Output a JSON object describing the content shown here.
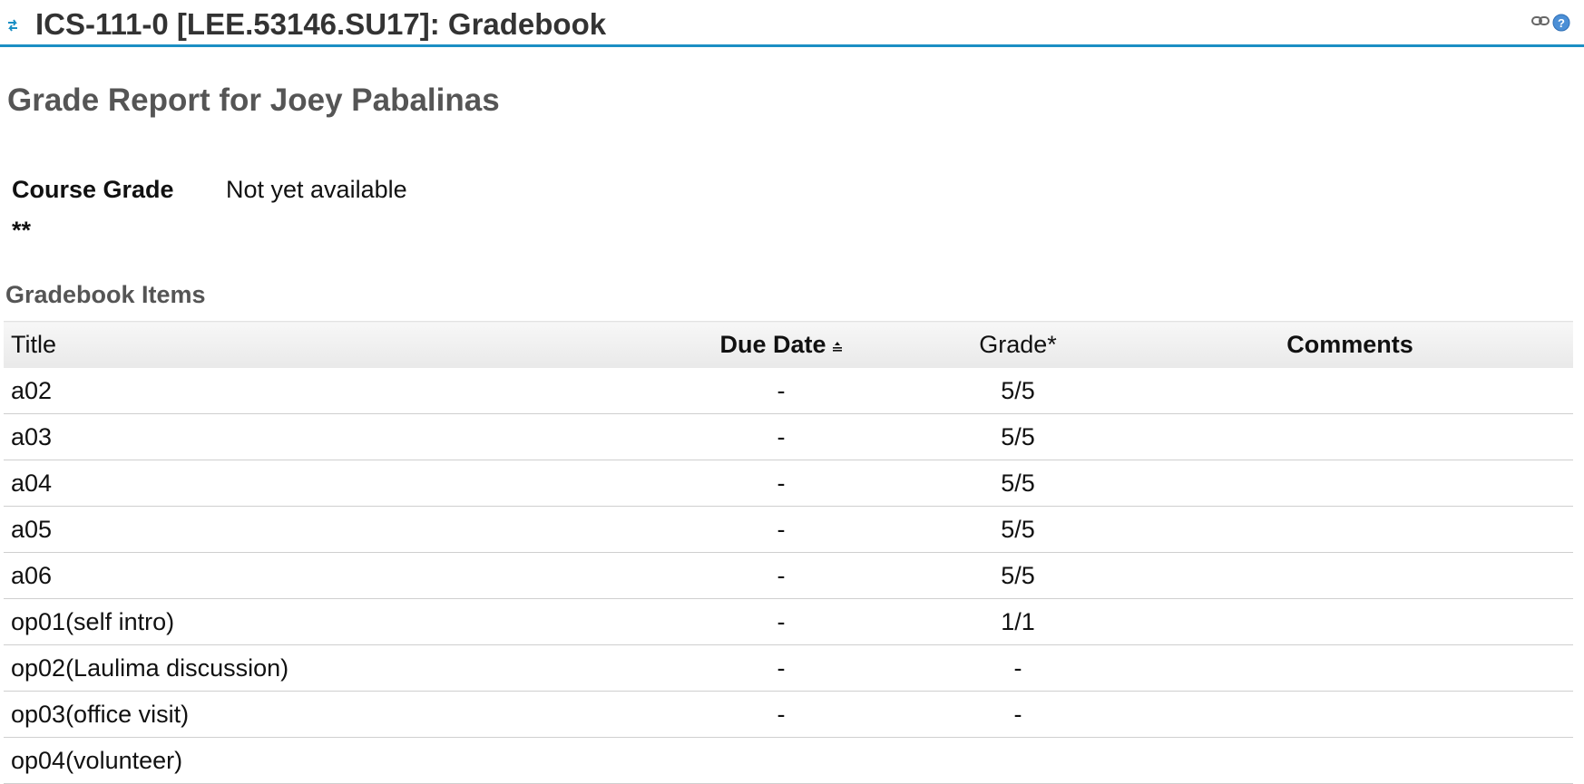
{
  "header": {
    "title": "ICS-111-0 [LEE.53146.SU17]: Gradebook",
    "icons": {
      "reset": "reset-icon",
      "link": "link-icon",
      "help": "help-icon"
    }
  },
  "report": {
    "heading": "Grade Report for Joey Pabalinas",
    "course_grade_label": "Course Grade",
    "course_grade_value": "Not yet available",
    "footnote_marker": "**"
  },
  "items": {
    "heading": "Gradebook Items",
    "columns": {
      "title": "Title",
      "due_date": "Due Date",
      "grade": "Grade*",
      "comments": "Comments"
    },
    "rows": [
      {
        "title": "a02",
        "due": "-",
        "grade": "5/5",
        "comments": ""
      },
      {
        "title": "a03",
        "due": "-",
        "grade": "5/5",
        "comments": ""
      },
      {
        "title": "a04",
        "due": "-",
        "grade": "5/5",
        "comments": ""
      },
      {
        "title": "a05",
        "due": "-",
        "grade": "5/5",
        "comments": ""
      },
      {
        "title": "a06",
        "due": "-",
        "grade": "5/5",
        "comments": ""
      },
      {
        "title": "op01(self intro)",
        "due": "-",
        "grade": "1/1",
        "comments": ""
      },
      {
        "title": "op02(Laulima discussion)",
        "due": "-",
        "grade": "-",
        "comments": ""
      },
      {
        "title": "op03(office visit)",
        "due": "-",
        "grade": "-",
        "comments": ""
      },
      {
        "title": "op04(volunteer)",
        "due": "",
        "grade": "",
        "comments": ""
      }
    ]
  },
  "colors": {
    "accent": "#1b8fc4",
    "heading_gray": "#555555"
  }
}
